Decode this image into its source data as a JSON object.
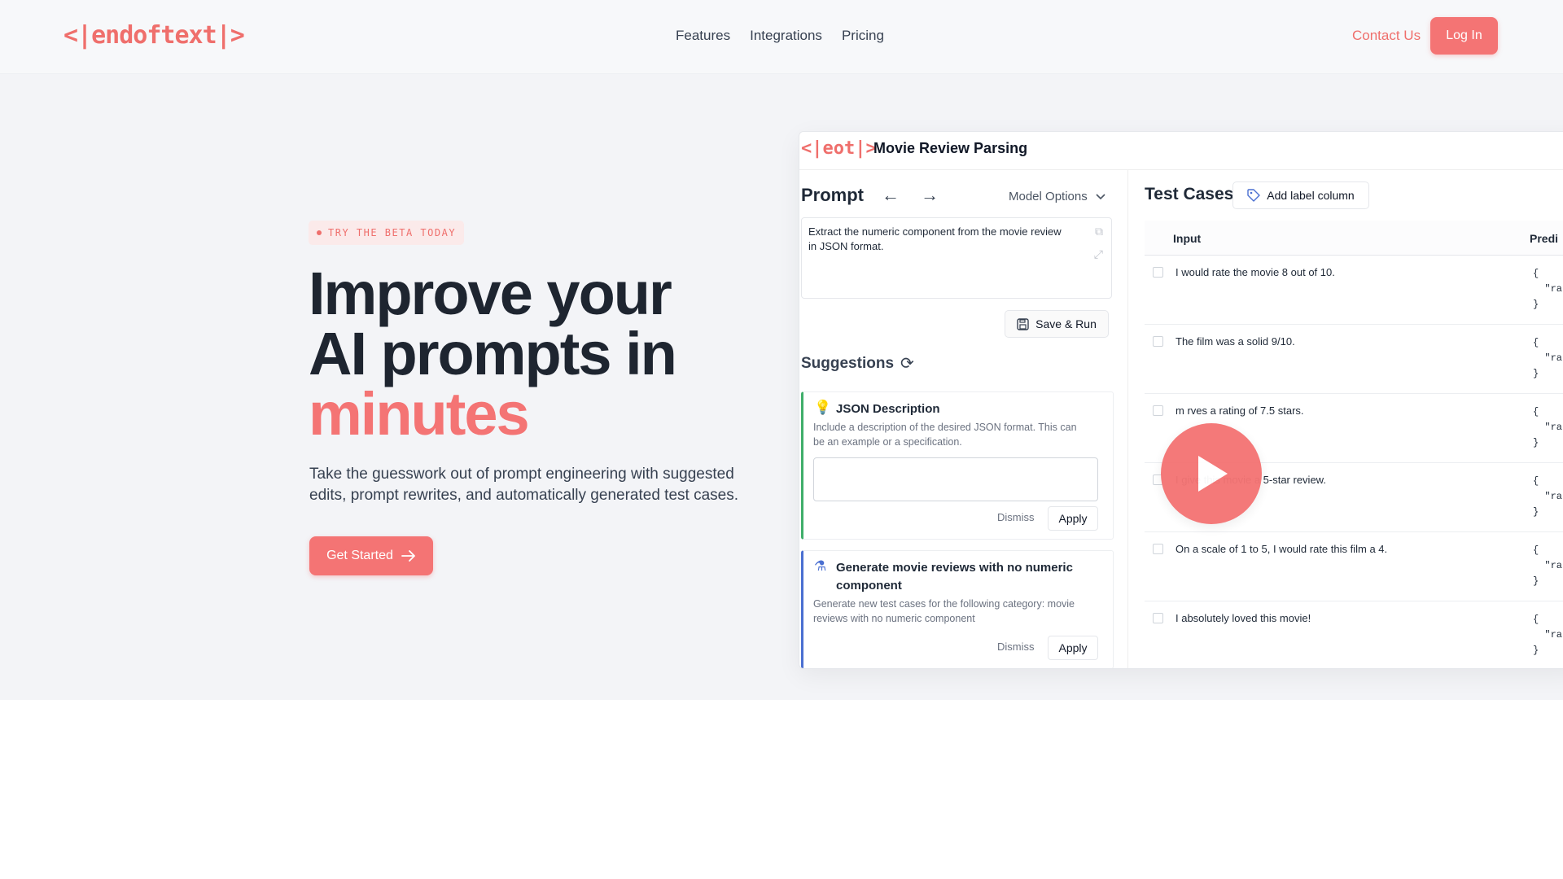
{
  "nav": {
    "logo": "<|endoftext|>",
    "links": [
      "Features",
      "Integrations",
      "Pricing"
    ],
    "contact": "Contact Us",
    "login": "Log In"
  },
  "hero": {
    "badge": "TRY THE BETA TODAY",
    "headline_line1": "Improve your",
    "headline_line2": "AI prompts in",
    "headline_accent": "minutes",
    "subtext": "Take the guesswork out of prompt engineering with suggested edits, prompt rewrites, and automatically generated test cases.",
    "cta": "Get Started"
  },
  "app": {
    "logo": "<|eot|>",
    "title": "Movie Review Parsing",
    "prompt": {
      "heading": "Prompt",
      "arrows": "← →",
      "model_options": "Model Options",
      "text": "Extract the numeric component from the movie review in JSON format.",
      "save_run": "Save & Run"
    },
    "suggestions": {
      "heading": "Suggestions",
      "cards": [
        {
          "title": "JSON Description",
          "desc": "Include a description of the desired JSON format. This can be an example or a specification.",
          "dismiss": "Dismiss",
          "apply": "Apply"
        },
        {
          "title": "Generate movie reviews with no numeric component",
          "desc": "Generate new test cases for the following category: movie reviews with no numeric component",
          "dismiss": "Dismiss",
          "apply": "Apply"
        }
      ]
    },
    "test_cases": {
      "heading": "Test Cases",
      "add_label": "Add label column",
      "col_input": "Input",
      "col_pred": "Predi",
      "rows": [
        {
          "input": "I would rate the movie 8 out of 10.",
          "pred": "{\n  \"rat\n}"
        },
        {
          "input": "The film was a solid 9/10.",
          "pred": "{\n  \"ratir\n}"
        },
        {
          "input": "m          rves a rating of 7.5 stars.",
          "pred": "{\n  \"rat\n}"
        },
        {
          "input": "I give this movie a 5-star review.",
          "pred": "{\n  \"rat\n}"
        },
        {
          "input": "On a scale of 1 to 5, I would rate this film a 4.",
          "pred": "{\n  \"rat\n}"
        },
        {
          "input": "I absolutely loved this movie!",
          "pred": "{\n  \"rat\n}"
        }
      ]
    }
  }
}
